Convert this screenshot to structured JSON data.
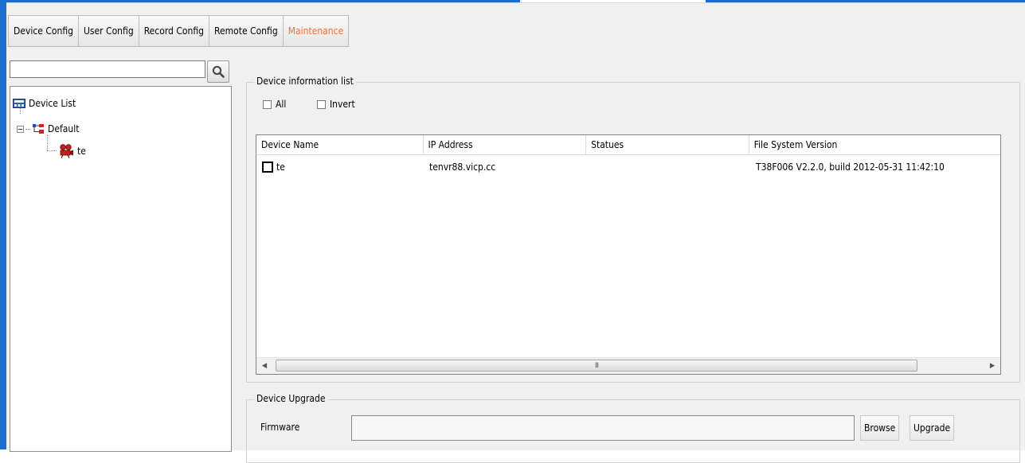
{
  "toolbar": {
    "tabs": [
      {
        "label": "Device Config",
        "active": false
      },
      {
        "label": "User Config",
        "active": false
      },
      {
        "label": "Record Config",
        "active": false
      },
      {
        "label": "Remote Config",
        "active": false
      },
      {
        "label": "Maintenance",
        "active": true
      }
    ],
    "active_color": "#e8703c"
  },
  "sidebar": {
    "search": {
      "value": "",
      "placeholder": ""
    },
    "tree": {
      "root": {
        "label": "Device List",
        "icon": "device-list-icon"
      },
      "group": {
        "label": "Default",
        "icon": "group-tree-icon",
        "expanded": true
      },
      "device": {
        "label": "te",
        "icon": "camera-icon"
      }
    }
  },
  "device_info": {
    "title": "Device information list",
    "select_all_label": "All",
    "invert_label": "Invert",
    "columns": [
      "Device Name",
      "IP Address",
      "Statues",
      "File System Version"
    ],
    "rows": [
      {
        "name": "te",
        "ip": "tenvr88.vicp.cc",
        "status": "",
        "fs_version": "T38F006 V2.2.0, build 2012-05-31 11:42:10",
        "checked": false
      }
    ],
    "scroll_thumb_grip": "III"
  },
  "upgrade": {
    "title": "Device Upgrade",
    "firmware_label": "Firmware",
    "firmware_value": "",
    "browse_label": "Browse",
    "upgrade_label": "Upgrade"
  },
  "colors": {
    "chrome": "#1c6fd1",
    "window_bg": "#f0f0f0"
  }
}
